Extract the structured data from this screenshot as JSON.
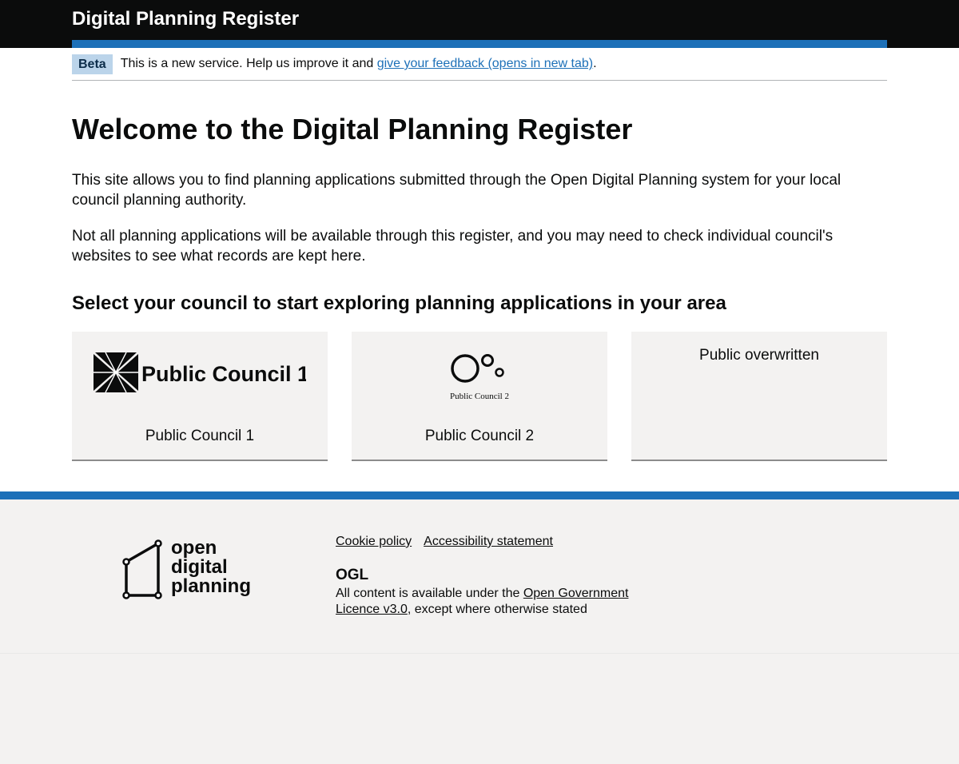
{
  "header": {
    "service_name": "Digital Planning Register"
  },
  "phase_banner": {
    "tag": "Beta",
    "text_before": "This is a new service. Help us improve it and ",
    "link_text": "give your feedback (opens in new tab)",
    "text_after": "."
  },
  "main": {
    "title": "Welcome to the Digital Planning Register",
    "paragraphs": [
      "This site allows you to find planning applications submitted through the Open Digital Planning system for your local council planning authority.",
      "Not all planning applications will be available through this register, and you may need to check individual council's websites to see what records are kept here."
    ],
    "subheading": "Select your council to start exploring planning applications in your area",
    "councils": [
      {
        "name": "Public Council 1",
        "logo_text": "Public Council 1"
      },
      {
        "name": "Public Council 2",
        "logo_text": "Public Council 2"
      },
      {
        "name": "Public overwritten"
      }
    ]
  },
  "footer": {
    "logo_text": [
      "open",
      "digital",
      "planning"
    ],
    "links": [
      "Cookie policy",
      "Accessibility statement"
    ],
    "ogl_logo": "OGL",
    "licence_before": "All content is available under the ",
    "licence_link": "Open Government Licence v3.0",
    "licence_after": ", except where otherwise stated"
  },
  "colors": {
    "brand_blue": "#1d70b8",
    "header_black": "#0b0c0c",
    "card_grey": "#f3f2f1",
    "beta_tag": "#bbd4ea"
  }
}
